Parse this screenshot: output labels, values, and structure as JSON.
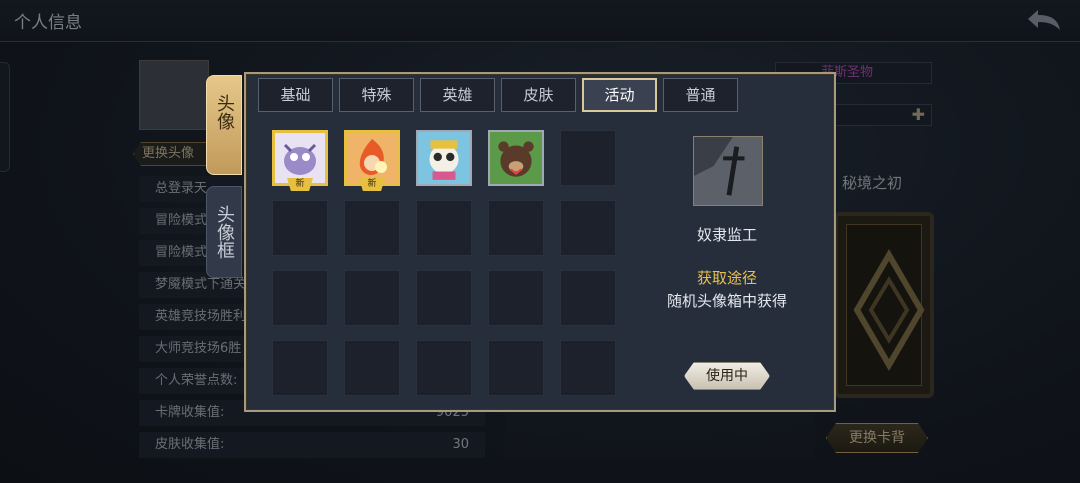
{
  "header": {
    "title": "个人信息"
  },
  "background": {
    "change_avatar_label": "更换头像",
    "stats": [
      {
        "label": "总登录天",
        "value": ""
      },
      {
        "label": "冒险模式",
        "value": ""
      },
      {
        "label": "冒险模式",
        "value": ""
      },
      {
        "label": "梦魇模式下通关",
        "value": ""
      },
      {
        "label": "英雄竞技场胜利",
        "value": ""
      },
      {
        "label": "大师竞技场6胜",
        "value": ""
      },
      {
        "label": "个人荣誉点数:",
        "value": ""
      },
      {
        "label": "卡牌收集值:",
        "value": "9025"
      },
      {
        "label": "皮肤收集值:",
        "value": "30"
      }
    ],
    "right_name": "菲斯圣物",
    "realm": "秘境之初",
    "change_card_back_label": "更换卡背"
  },
  "modal": {
    "side_tabs": [
      {
        "label": "头像",
        "active": true
      },
      {
        "label": "头像框",
        "active": false
      }
    ],
    "tabs": [
      {
        "label": "基础",
        "active": false
      },
      {
        "label": "特殊",
        "active": false
      },
      {
        "label": "英雄",
        "active": false
      },
      {
        "label": "皮肤",
        "active": false
      },
      {
        "label": "活动",
        "active": true
      },
      {
        "label": "普通",
        "active": false
      }
    ],
    "new_tag": "新",
    "avatars": [
      {
        "icon": "ghost-cow-avatar-icon",
        "new": true
      },
      {
        "icon": "fire-girl-avatar-icon",
        "new": true
      },
      {
        "icon": "panda-chef-avatar-icon",
        "new": false
      },
      {
        "icon": "bear-warrior-avatar-icon",
        "new": false
      }
    ],
    "detail": {
      "name": "奴隶监工",
      "source_title": "获取途径",
      "source": "随机头像箱中获得",
      "use_button": "使用中"
    }
  }
}
